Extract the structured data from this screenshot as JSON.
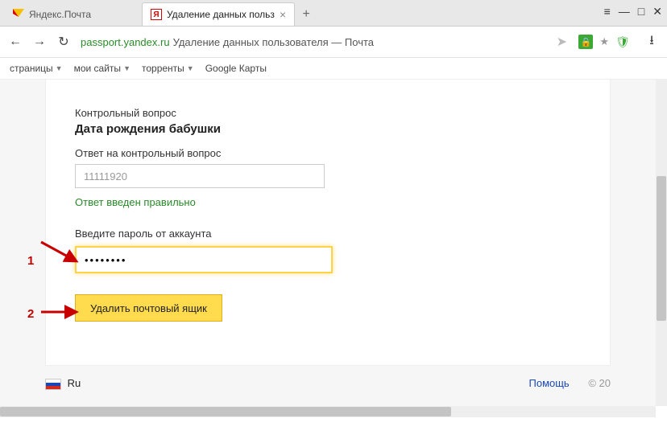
{
  "tabs": [
    {
      "title": "Яндекс.Почта"
    },
    {
      "title": "Удаление данных польз"
    }
  ],
  "windowControls": {
    "menu": "≡",
    "min": "—",
    "max": "□",
    "close": "✕"
  },
  "address": {
    "domain": "passport.yandex.ru",
    "path": "Удаление данных пользователя — Почта"
  },
  "bookmarks": [
    "страницы",
    "мои сайты",
    "торренты",
    "Google Карты"
  ],
  "form": {
    "sec_label": "Контрольный вопрос",
    "question": "Дата рождения бабушки",
    "answer_label": "Ответ на контрольный вопрос",
    "answer_value": "11111920",
    "answer_ok": "Ответ введен правильно",
    "pass_label": "Введите пароль от аккаунта",
    "pass_value": "••••••••",
    "delete_label": "Удалить почтовый ящик"
  },
  "footer": {
    "lang": "Ru",
    "help": "Помощь",
    "copy": "© 20"
  },
  "annotations": {
    "one": "1",
    "two": "2"
  }
}
